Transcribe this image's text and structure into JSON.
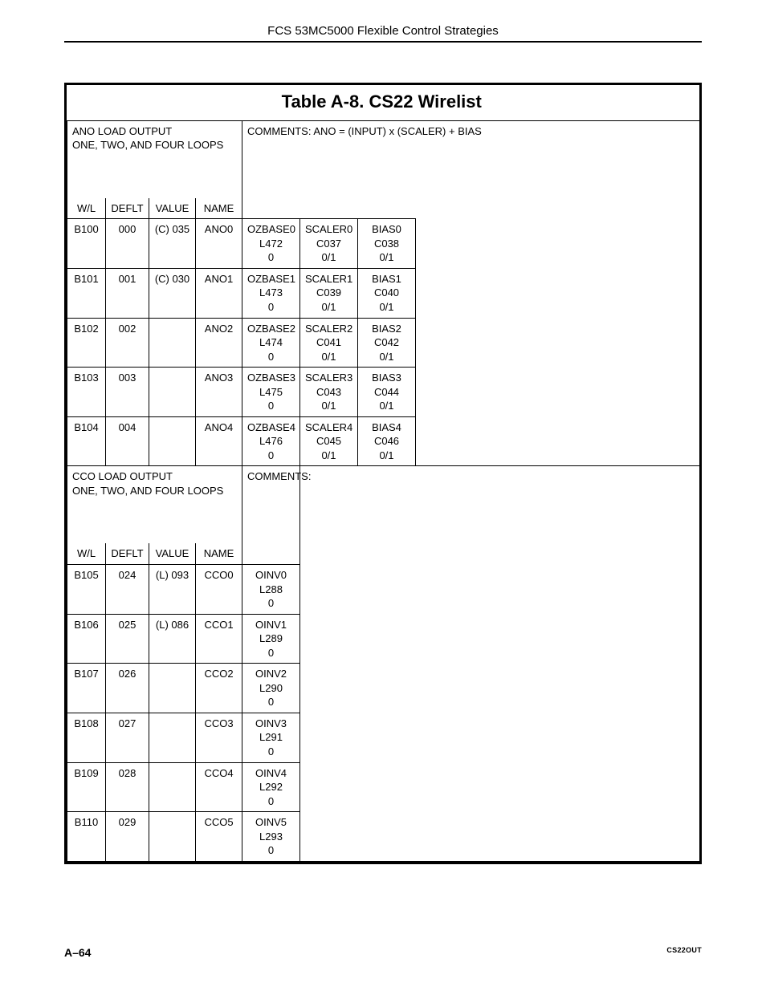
{
  "header": "FCS 53MC5000 Flexible Control Strategies",
  "table_title": "Table A-8.  CS22 Wirelist",
  "section1": {
    "name": "ANO LOAD OUTPUT\nONE, TWO, AND FOUR LOOPS",
    "comments": "COMMENTS:  ANO =  (INPUT) x (SCALER) + BIAS",
    "col_headers": [
      "W/L",
      "DEFLT",
      "VALUE",
      "NAME"
    ],
    "rows": [
      {
        "wl": "B100",
        "def": "000",
        "val": "(C) 035",
        "nam": "ANO0",
        "p1": "OZBASE0\nL472\n0",
        "p2": "SCALER0\nC037\n0/1",
        "p3": "BIAS0\nC038\n0/1"
      },
      {
        "wl": "B101",
        "def": "001",
        "val": "(C) 030",
        "nam": "ANO1",
        "p1": "OZBASE1\nL473\n0",
        "p2": "SCALER1\nC039\n0/1",
        "p3": "BIAS1\nC040\n0/1"
      },
      {
        "wl": "B102",
        "def": "002",
        "val": "",
        "nam": "ANO2",
        "p1": "OZBASE2\nL474\n0",
        "p2": "SCALER2\nC041\n0/1",
        "p3": "BIAS2\nC042\n0/1"
      },
      {
        "wl": "B103",
        "def": "003",
        "val": "",
        "nam": "ANO3",
        "p1": "OZBASE3\nL475\n0",
        "p2": "SCALER3\nC043\n0/1",
        "p3": "BIAS3\nC044\n0/1"
      },
      {
        "wl": "B104",
        "def": "004",
        "val": "",
        "nam": "ANO4",
        "p1": "OZBASE4\nL476\n0",
        "p2": "SCALER4\nC045\n0/1",
        "p3": "BIAS4\nC046\n0/1"
      }
    ]
  },
  "section2": {
    "name": "CCO LOAD OUTPUT\nONE, TWO, AND FOUR LOOPS",
    "comments": "COMMENTS:",
    "col_headers": [
      "W/L",
      "DEFLT",
      "VALUE",
      "NAME"
    ],
    "rows": [
      {
        "wl": "B105",
        "def": "024",
        "val": "(L) 093",
        "nam": "CCO0",
        "p1": "OINV0\nL288\n0"
      },
      {
        "wl": "B106",
        "def": "025",
        "val": "(L) 086",
        "nam": "CCO1",
        "p1": "OINV1\nL289\n0"
      },
      {
        "wl": "B107",
        "def": "026",
        "val": "",
        "nam": "CCO2",
        "p1": "OINV2\nL290\n0"
      },
      {
        "wl": "B108",
        "def": "027",
        "val": "",
        "nam": "CCO3",
        "p1": "OINV3\nL291\n0"
      },
      {
        "wl": "B109",
        "def": "028",
        "val": "",
        "nam": "CCO4",
        "p1": "OINV4\nL292\n0"
      },
      {
        "wl": "B110",
        "def": "029",
        "val": "",
        "nam": "CCO5",
        "p1": "OINV5\nL293\n0"
      }
    ]
  },
  "footer": {
    "page": "A–64",
    "code": "CS22OUT"
  }
}
